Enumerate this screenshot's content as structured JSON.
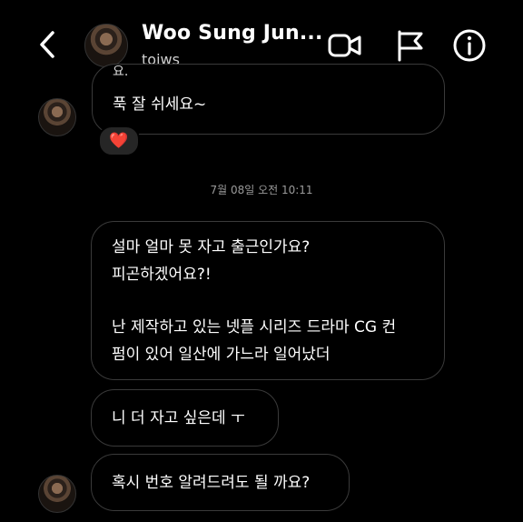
{
  "header": {
    "back_icon": "chevron-left-icon",
    "title": "Woo Sung Jun...",
    "username": "tojws",
    "video_icon": "video-camera-icon",
    "flag_icon": "flag-icon",
    "info_icon": "info-icon"
  },
  "messages": {
    "first": {
      "cut_text": "요.",
      "text": "푹 잘 쉬세요~",
      "reaction": "❤️"
    },
    "timestamp": "7월 08일 오전 10:11",
    "long": {
      "lines": [
        "설마 얼마 못 자고 출근인가요?",
        "피곤하겠어요?!",
        "난 제작하고 있는 넷플 시리즈 드라마 CG 컨",
        "펌이 있어 일산에 가느라 일어났더"
      ]
    },
    "short1": "니 더 자고 싶은데 ㅜ",
    "short2": "혹시 번호 알려드려도 될 까요?"
  },
  "colors": {
    "background": "#000000",
    "bubble_border": "#3a3a3a",
    "heart": "#e0243a"
  }
}
